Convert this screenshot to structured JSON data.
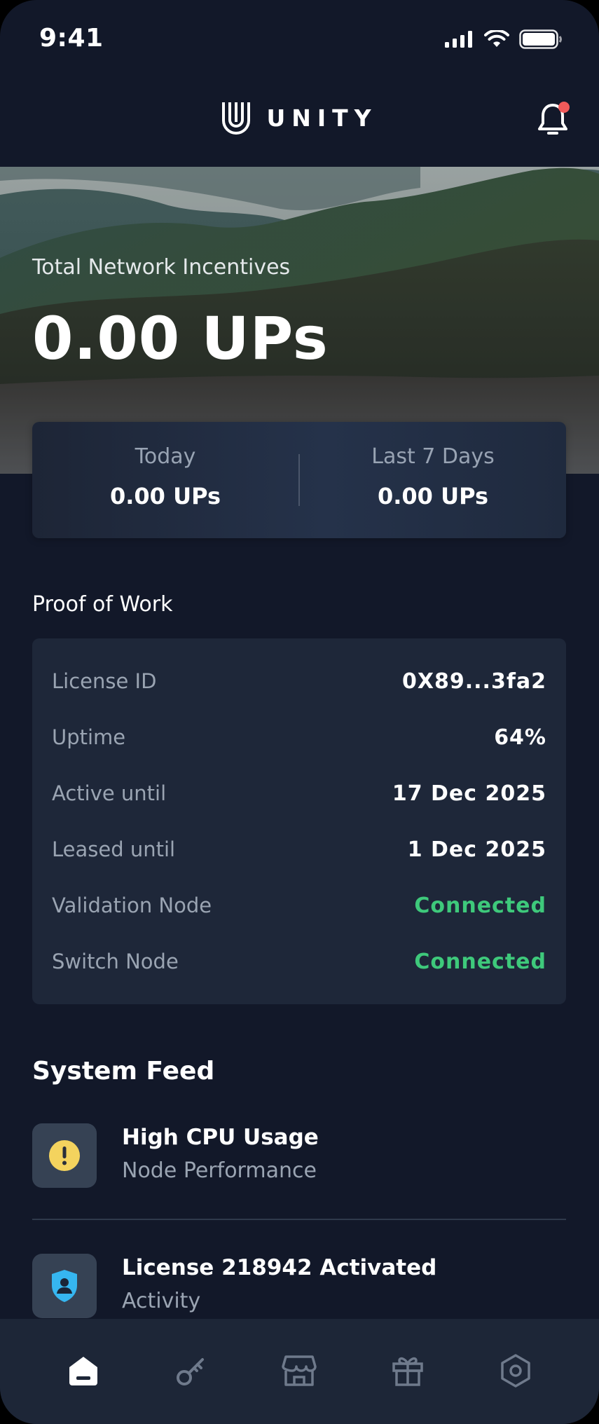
{
  "status_bar": {
    "time": "9:41"
  },
  "header": {
    "brand_name": "UNITY",
    "logo_icon": "unity-logo-icon",
    "notification_icon": "bell-icon",
    "notification_dot_color": "#f05a5a"
  },
  "hero": {
    "label": "Total Network Incentives",
    "value": "0.00 UPs"
  },
  "stats": {
    "today_label": "Today",
    "today_value": "0.00 UPs",
    "week_label": "Last 7 Days",
    "week_value": "0.00 UPs"
  },
  "proof_of_work": {
    "title": "Proof of Work",
    "rows": [
      {
        "key": "License ID",
        "value": "0X89...3fa2"
      },
      {
        "key": "Uptime",
        "value": "64%"
      },
      {
        "key": "Active until",
        "value": "17 Dec 2025"
      },
      {
        "key": "Leased until",
        "value": "1 Dec 2025"
      },
      {
        "key": "Validation Node",
        "value": "Connected"
      },
      {
        "key": "Switch Node",
        "value": "Connected"
      }
    ],
    "connected_color": "#3ec97b"
  },
  "system_feed": {
    "title": "System Feed",
    "items": [
      {
        "title": "High CPU Usage",
        "subtitle": "Node Performance",
        "icon": "warning-icon",
        "icon_color": "#f4d35e"
      },
      {
        "title": "License 218942 Activated",
        "subtitle": "Activity",
        "icon": "shield-user-icon",
        "icon_color": "#36b6f0"
      }
    ]
  },
  "bottom_nav": {
    "items": [
      {
        "icon": "home-icon",
        "active": true
      },
      {
        "icon": "key-icon",
        "active": false
      },
      {
        "icon": "store-icon",
        "active": false
      },
      {
        "icon": "gift-icon",
        "active": false
      },
      {
        "icon": "settings-hex-icon",
        "active": false
      }
    ]
  }
}
